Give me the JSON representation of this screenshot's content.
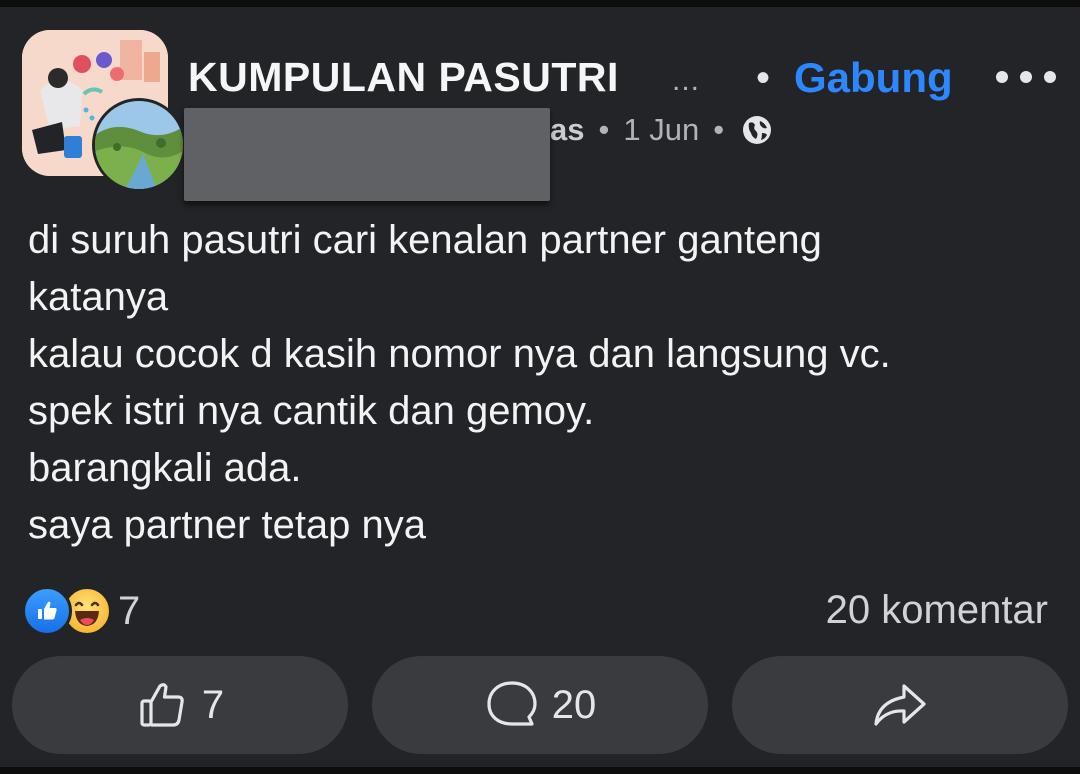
{
  "post": {
    "group_name": "KUMPULAN PASUTRI",
    "group_name_ellipsis": "...",
    "separator": "•",
    "join_label": "Gabung",
    "author_fragment": "as",
    "date": "1 Jun",
    "body_lines": [
      "di suruh pasutri cari kenalan partner ganteng",
      "katanya",
      "kalau cocok d kasih nomor nya dan langsung vc.",
      "spek istri nya cantik dan gemoy.",
      "barangkali ada.",
      "saya partner tetap nya"
    ]
  },
  "reactions": {
    "icons": [
      "like-icon",
      "haha-icon"
    ],
    "count": "7",
    "comments_label": "20 komentar"
  },
  "actions": {
    "like_count": "7",
    "comment_count": "20"
  },
  "colors": {
    "background": "#232427",
    "link_blue": "#2d88ff",
    "button_bg": "#3a3b3e",
    "text_primary": "#f2f3f5",
    "text_secondary": "#b0b3b8"
  }
}
